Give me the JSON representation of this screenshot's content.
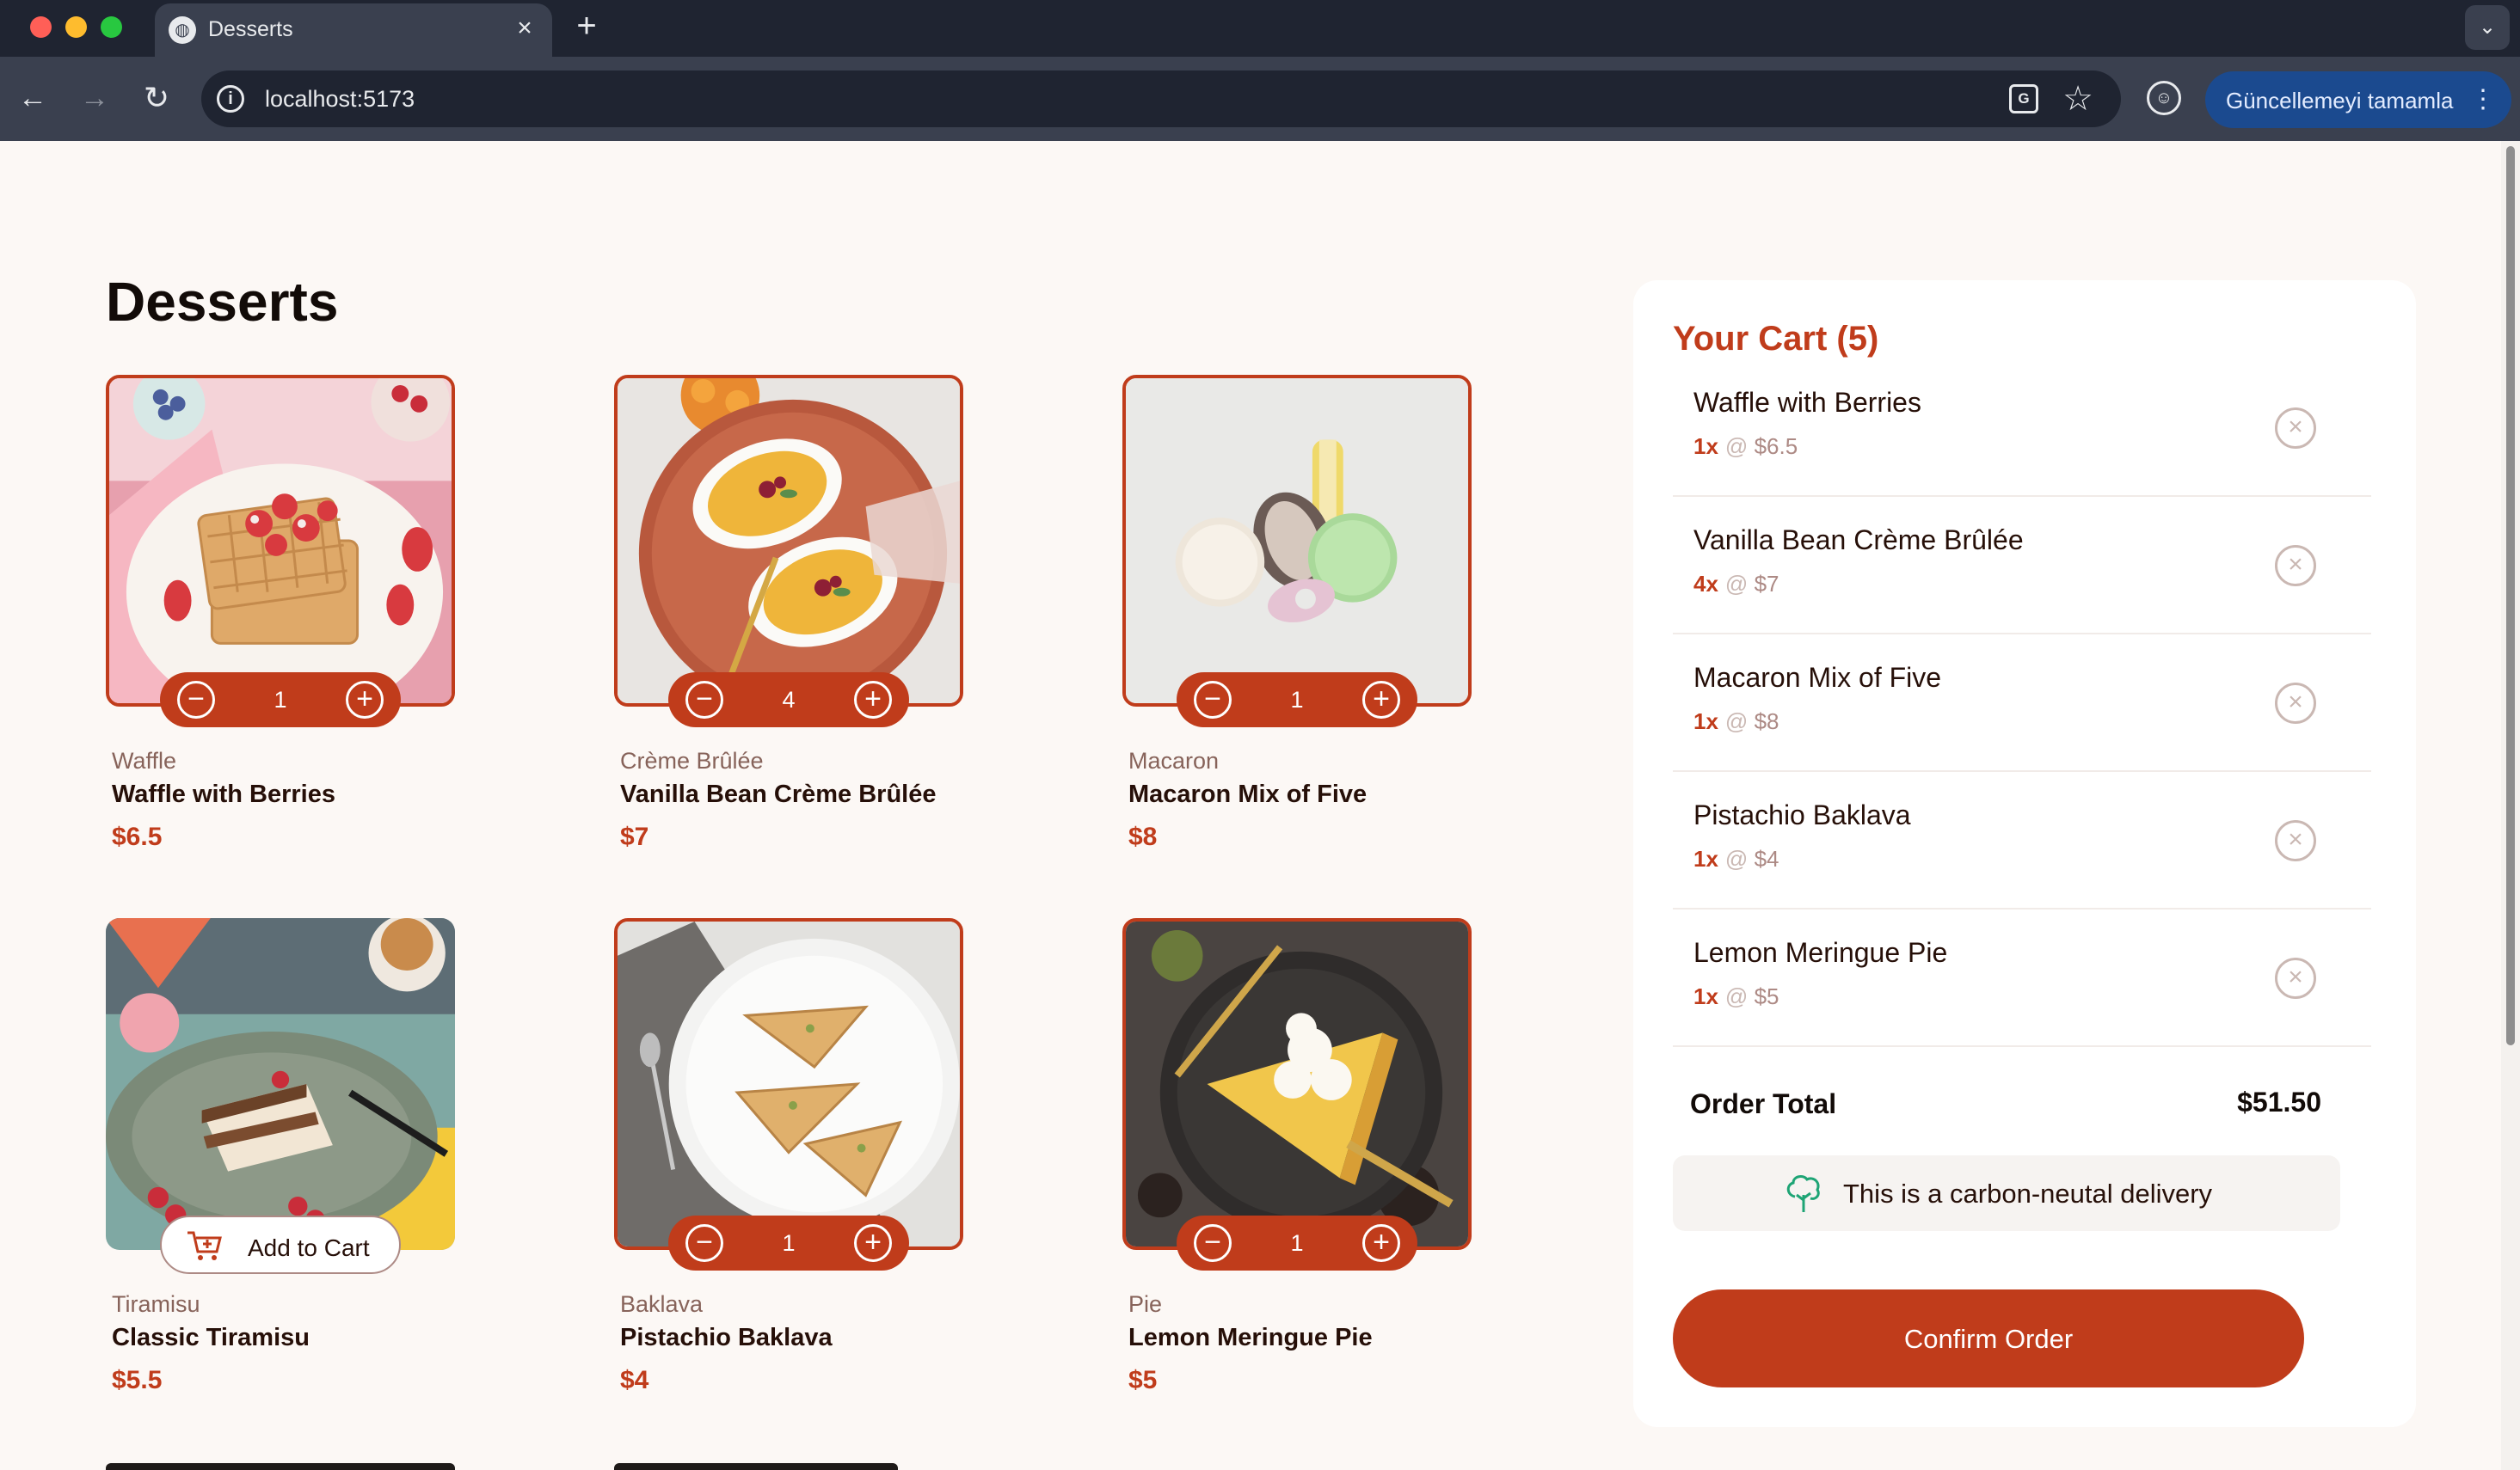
{
  "browser": {
    "tab_title": "Desserts",
    "url": "localhost:5173",
    "update_button_label": "Güncellemeyi tamamla"
  },
  "page": {
    "title": "Desserts"
  },
  "products": [
    {
      "category": "Waffle",
      "name": "Waffle with Berries",
      "price": "$6.5",
      "in_cart": true,
      "quantity": "1"
    },
    {
      "category": "Crème Brûlée",
      "name": "Vanilla Bean Crème Brûlée",
      "price": "$7",
      "in_cart": true,
      "quantity": "4"
    },
    {
      "category": "Macaron",
      "name": "Macaron Mix of Five",
      "price": "$8",
      "in_cart": true,
      "quantity": "1"
    },
    {
      "category": "Tiramisu",
      "name": "Classic Tiramisu",
      "price": "$5.5",
      "in_cart": false,
      "add_label": "Add to Cart"
    },
    {
      "category": "Baklava",
      "name": "Pistachio Baklava",
      "price": "$4",
      "in_cart": true,
      "quantity": "1"
    },
    {
      "category": "Pie",
      "name": "Lemon Meringue Pie",
      "price": "$5",
      "in_cart": true,
      "quantity": "1"
    }
  ],
  "cart": {
    "title": "Your Cart (5)",
    "items": [
      {
        "name": "Waffle with Berries",
        "qty": "1x",
        "unit_price": "$6.5"
      },
      {
        "name": "Vanilla Bean Crème Brûlée",
        "qty": "4x",
        "unit_price": "$7"
      },
      {
        "name": "Macaron Mix of Five",
        "qty": "1x",
        "unit_price": "$8"
      },
      {
        "name": "Pistachio Baklava",
        "qty": "1x",
        "unit_price": "$4"
      },
      {
        "name": "Lemon Meringue Pie",
        "qty": "1x",
        "unit_price": "$5"
      }
    ],
    "at_symbol": "@",
    "order_total_label": "Order Total",
    "order_total_value": "$51.50",
    "carbon_text": "This is a carbon-neutal delivery",
    "confirm_label": "Confirm Order"
  },
  "colors": {
    "accent": "#c03c1b",
    "page_background": "#fcf8f5",
    "text_dark": "#260f08",
    "text_muted": "#87635a"
  },
  "icons": {
    "minus": "minus-circle-icon",
    "plus": "plus-circle-icon",
    "remove": "remove-circle-icon",
    "cart": "add-to-cart-icon",
    "tree": "carbon-neutral-tree-icon"
  }
}
